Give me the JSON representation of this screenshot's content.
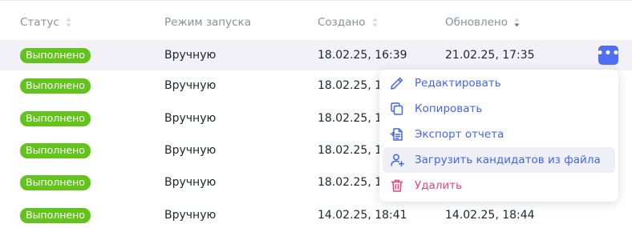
{
  "table": {
    "columns": [
      {
        "key": "status",
        "label": "Статус",
        "sortable": true,
        "sort_state": "none"
      },
      {
        "key": "mode",
        "label": "Режим запуска",
        "sortable": false
      },
      {
        "key": "created",
        "label": "Создано",
        "sortable": true,
        "sort_state": "none"
      },
      {
        "key": "updated",
        "label": "Обновлено",
        "sortable": true,
        "sort_state": "descending"
      }
    ],
    "rows": [
      {
        "status": "Выполнено",
        "mode": "Вручную",
        "created": "18.02.25, 16:39",
        "updated": "21.02.25, 17:35"
      },
      {
        "status": "Выполнено",
        "mode": "Вручную",
        "created": "18.02.25, 1",
        "updated": ""
      },
      {
        "status": "Выполнено",
        "mode": "Вручную",
        "created": "18.02.25, 1",
        "updated": ""
      },
      {
        "status": "Выполнено",
        "mode": "Вручную",
        "created": "18.02.25, 1",
        "updated": ""
      },
      {
        "status": "Выполнено",
        "mode": "Вручную",
        "created": "18.02.25, 1",
        "updated": ""
      },
      {
        "status": "Выполнено",
        "mode": "Вручную",
        "created": "14.02.25, 18:41",
        "updated": "14.02.25, 18:44"
      }
    ],
    "more_button": {
      "label": "•••",
      "icon": "more-horizontal-icon"
    }
  },
  "context_menu": {
    "items": [
      {
        "label": "Редактировать",
        "icon": "pencil-icon",
        "variant": "normal"
      },
      {
        "label": "Копировать",
        "icon": "copy-icon",
        "variant": "normal"
      },
      {
        "label": "Экспорт отчета",
        "icon": "export-report-icon",
        "variant": "normal"
      },
      {
        "label": "Загрузить кандидатов из файла",
        "icon": "add-user-icon",
        "variant": "hover"
      },
      {
        "label": "Удалить",
        "icon": "trash-icon",
        "variant": "danger"
      }
    ]
  },
  "colors": {
    "status_badge": "#62c31b",
    "accent": "#4266e8",
    "danger": "#e8437a",
    "header_text": "#8b8f9b",
    "active_row": "#f2f1f7",
    "hover_item": "#eff0f7"
  }
}
